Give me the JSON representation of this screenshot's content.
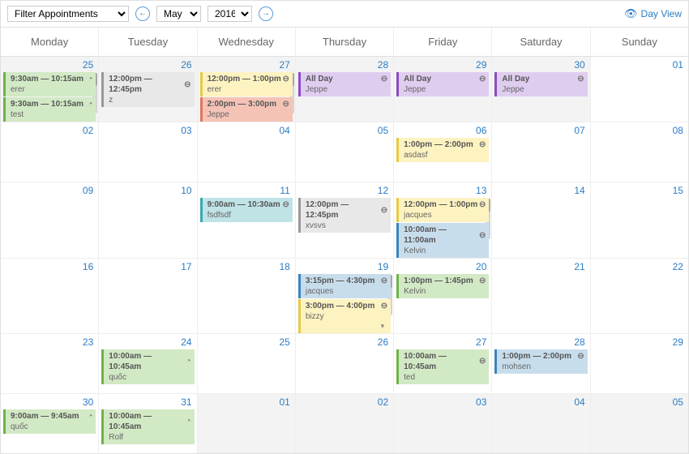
{
  "toolbar": {
    "filter_label": "Filter Appointments",
    "month": "May",
    "year": "2016",
    "dayview": "Day View"
  },
  "days": [
    "Monday",
    "Tuesday",
    "Wednesday",
    "Thursday",
    "Friday",
    "Saturday",
    "Sunday"
  ],
  "weeks": [
    {
      "cells": [
        {
          "num": "25",
          "other": true,
          "scroll": true,
          "events": [
            {
              "time": "9:30am — 10:15am",
              "who": "erer",
              "cls": "c-green",
              "ico": "clock"
            },
            {
              "time": "9:30am — 10:15am",
              "who": "test",
              "cls": "c-green",
              "ico": "clock"
            }
          ]
        },
        {
          "num": "26",
          "other": true,
          "events": [
            {
              "time": "12:00pm — 12:45pm",
              "who": "z",
              "cls": "c-grey",
              "ico": "circle"
            }
          ]
        },
        {
          "num": "27",
          "other": true,
          "scroll": true,
          "events": [
            {
              "time": "12:00pm — 1:00pm",
              "who": "erer",
              "cls": "c-yellow",
              "ico": "circle"
            },
            {
              "time": "2:00pm — 3:00pm",
              "who": "Jeppe",
              "cls": "c-salmon",
              "ico": "circle"
            }
          ]
        },
        {
          "num": "28",
          "other": true,
          "events": [
            {
              "time": "All Day",
              "who": "Jeppe",
              "cls": "c-purple",
              "ico": "circle"
            }
          ]
        },
        {
          "num": "29",
          "other": true,
          "events": [
            {
              "time": "All Day",
              "who": "Jeppe",
              "cls": "c-purple",
              "ico": "circle"
            }
          ]
        },
        {
          "num": "30",
          "other": true,
          "events": [
            {
              "time": "All Day",
              "who": "Jeppe",
              "cls": "c-purple",
              "ico": "circle"
            }
          ]
        },
        {
          "num": "01",
          "other": false,
          "events": []
        }
      ]
    },
    {
      "cells": [
        {
          "num": "02",
          "events": []
        },
        {
          "num": "03",
          "events": []
        },
        {
          "num": "04",
          "events": []
        },
        {
          "num": "05",
          "events": []
        },
        {
          "num": "06",
          "events": [
            {
              "time": "1:00pm — 2:00pm",
              "who": "asdasf",
              "cls": "c-yellow",
              "ico": "circle"
            }
          ]
        },
        {
          "num": "07",
          "events": []
        },
        {
          "num": "08",
          "events": []
        }
      ]
    },
    {
      "cells": [
        {
          "num": "09",
          "events": []
        },
        {
          "num": "10",
          "events": []
        },
        {
          "num": "11",
          "events": [
            {
              "time": "9:00am — 10:30am",
              "who": "fsdfsdf",
              "cls": "c-teal",
              "ico": "circle"
            }
          ]
        },
        {
          "num": "12",
          "events": [
            {
              "time": "12:00pm — 12:45pm",
              "who": "xvsvs",
              "cls": "c-grey",
              "ico": "circle"
            }
          ]
        },
        {
          "num": "13",
          "scroll": true,
          "events": [
            {
              "time": "12:00pm — 1:00pm",
              "who": "jacques",
              "cls": "c-yellow",
              "ico": "circle"
            },
            {
              "time": "10:00am — 11:00am",
              "who": "Kelvin",
              "cls": "c-blue",
              "ico": "circle"
            }
          ]
        },
        {
          "num": "14",
          "events": []
        },
        {
          "num": "15",
          "events": []
        }
      ]
    },
    {
      "cells": [
        {
          "num": "16",
          "events": []
        },
        {
          "num": "17",
          "events": []
        },
        {
          "num": "18",
          "events": []
        },
        {
          "num": "19",
          "scroll": true,
          "events": [
            {
              "time": "3:15pm — 4:30pm",
              "who": "jacques",
              "cls": "c-blue",
              "ico": "circle"
            },
            {
              "time": "3:00pm — 4:00pm",
              "who": "bizzy",
              "cls": "c-yellow",
              "ico": "circle",
              "drop": true
            }
          ]
        },
        {
          "num": "20",
          "events": [
            {
              "time": "1:00pm — 1:45pm",
              "who": "Kelvin",
              "cls": "c-green",
              "ico": "circle"
            }
          ]
        },
        {
          "num": "21",
          "events": []
        },
        {
          "num": "22",
          "events": []
        }
      ]
    },
    {
      "cells": [
        {
          "num": "23",
          "events": []
        },
        {
          "num": "24",
          "events": [
            {
              "time": "10:00am — 10:45am",
              "who": "quốc",
              "cls": "c-green",
              "ico": "clock"
            }
          ]
        },
        {
          "num": "25",
          "events": []
        },
        {
          "num": "26",
          "events": []
        },
        {
          "num": "27",
          "events": [
            {
              "time": "10:00am — 10:45am",
              "who": "ted",
              "cls": "c-green",
              "ico": "circle"
            }
          ]
        },
        {
          "num": "28",
          "events": [
            {
              "time": "1:00pm — 2:00pm",
              "who": "mohsen",
              "cls": "c-blue",
              "ico": "circle"
            }
          ]
        },
        {
          "num": "29",
          "events": []
        }
      ]
    },
    {
      "cells": [
        {
          "num": "30",
          "events": [
            {
              "time": "9:00am — 9:45am",
              "who": "quốc",
              "cls": "c-green",
              "ico": "clock"
            }
          ]
        },
        {
          "num": "31",
          "events": [
            {
              "time": "10:00am — 10:45am",
              "who": "Rolf",
              "cls": "c-green",
              "ico": "clock"
            }
          ]
        },
        {
          "num": "01",
          "other": true,
          "events": []
        },
        {
          "num": "02",
          "other": true,
          "events": []
        },
        {
          "num": "03",
          "other": true,
          "events": []
        },
        {
          "num": "04",
          "other": true,
          "events": []
        },
        {
          "num": "05",
          "other": true,
          "events": []
        }
      ]
    }
  ]
}
